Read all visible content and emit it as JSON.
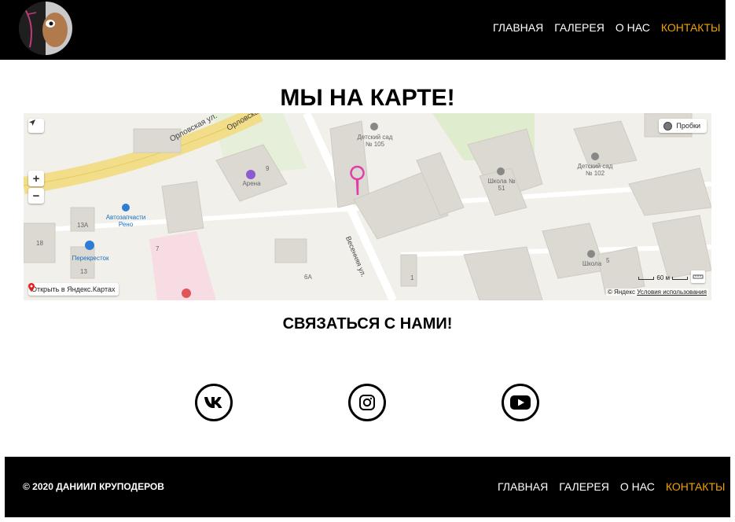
{
  "header": {
    "logo_icon": "logo-avatar",
    "nav": [
      {
        "label": "ГЛАВНАЯ",
        "active": false
      },
      {
        "label": "ГАЛЕРЕЯ",
        "active": false
      },
      {
        "label": "О НАС",
        "active": false
      },
      {
        "label": "КОНТАКТЫ",
        "active": true
      }
    ],
    "active_color": "#f2a100"
  },
  "map_section": {
    "title": "МЫ НА КАРТЕ!",
    "traffic_label": "Пробки",
    "open_in_yandex": "Открыть в Яндекс.Картах",
    "copyright": "© Яндекс",
    "terms": "Условия использования",
    "scale": "60 м",
    "streets": [
      "Орловская ул.",
      "Орловская ул.",
      "Весенняя ул."
    ],
    "places": [
      {
        "name": "Детский сад № 105"
      },
      {
        "name": "Арена"
      },
      {
        "name": "Автозапчасти Рено"
      },
      {
        "name": "Перекресток"
      },
      {
        "name": "Школа № 51"
      },
      {
        "name": "Детский сад № 102"
      },
      {
        "name": "Школа"
      }
    ],
    "house_numbers": [
      "9",
      "13А",
      "18",
      "13",
      "7",
      "6А",
      "1",
      "5"
    ]
  },
  "contact": {
    "title": "СВЯЗАТЬСЯ С НАМИ!",
    "socials": [
      {
        "icon": "vk-icon"
      },
      {
        "icon": "instagram-icon"
      },
      {
        "icon": "youtube-icon"
      }
    ]
  },
  "footer": {
    "copyright": "© 2020 ДАНИИЛ КРУПОДЕРОВ",
    "nav": [
      {
        "label": "ГЛАВНАЯ",
        "active": false
      },
      {
        "label": "ГАЛЕРЕЯ",
        "active": false
      },
      {
        "label": "О НАС",
        "active": false
      },
      {
        "label": "КОНТАКТЫ",
        "active": true
      }
    ]
  }
}
